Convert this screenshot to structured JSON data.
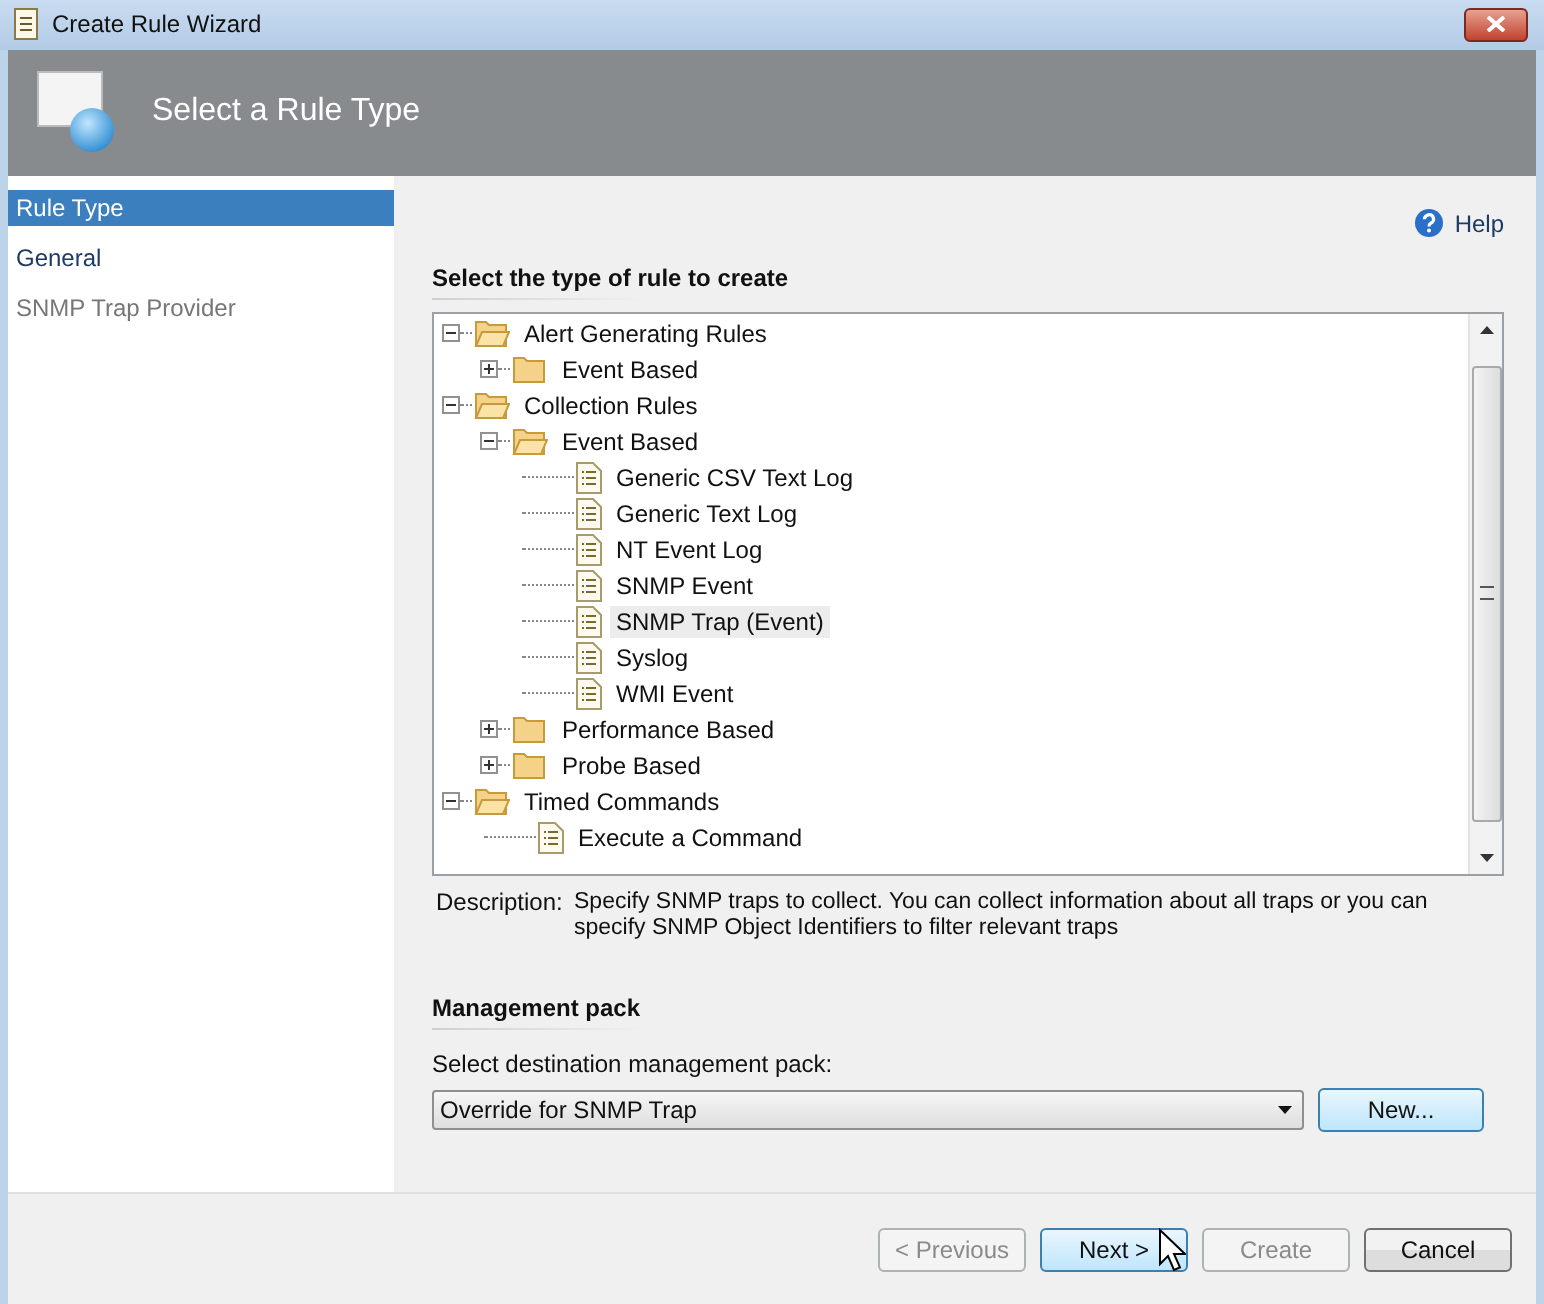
{
  "window": {
    "title": "Create Rule Wizard"
  },
  "header": {
    "title": "Select a Rule Type"
  },
  "sidebar": {
    "items": [
      {
        "label": "Rule Type",
        "selected": true,
        "disabled": false
      },
      {
        "label": "General",
        "selected": false,
        "disabled": false
      },
      {
        "label": "SNMP Trap Provider",
        "selected": false,
        "disabled": true
      }
    ]
  },
  "help": {
    "label": "Help"
  },
  "rule_type": {
    "heading": "Select the type of rule to create",
    "tree": [
      {
        "kind": "folder",
        "label": "Alert Generating Rules",
        "expanded": true,
        "selected": false,
        "children": [
          {
            "kind": "folder",
            "label": "Event Based",
            "expanded": false,
            "selected": false
          }
        ]
      },
      {
        "kind": "folder",
        "label": "Collection Rules",
        "expanded": true,
        "selected": false,
        "children": [
          {
            "kind": "folder",
            "label": "Event Based",
            "expanded": true,
            "selected": false,
            "children": [
              {
                "kind": "rule",
                "label": "Generic CSV Text Log",
                "selected": false
              },
              {
                "kind": "rule",
                "label": "Generic Text Log",
                "selected": false
              },
              {
                "kind": "rule",
                "label": "NT Event Log",
                "selected": false
              },
              {
                "kind": "rule",
                "label": "SNMP Event",
                "selected": false
              },
              {
                "kind": "rule",
                "label": "SNMP Trap (Event)",
                "selected": true
              },
              {
                "kind": "rule",
                "label": "Syslog",
                "selected": false
              },
              {
                "kind": "rule",
                "label": "WMI Event",
                "selected": false
              }
            ]
          },
          {
            "kind": "folder",
            "label": "Performance Based",
            "expanded": false,
            "selected": false
          },
          {
            "kind": "folder",
            "label": "Probe Based",
            "expanded": false,
            "selected": false
          }
        ]
      },
      {
        "kind": "folder",
        "label": "Timed Commands",
        "expanded": true,
        "selected": false,
        "children": [
          {
            "kind": "rule",
            "label": "Execute a Command",
            "selected": false
          }
        ]
      }
    ],
    "description_label": "Description:",
    "description": "Specify SNMP traps to collect. You can collect information about all traps or you can specify SNMP Object Identifiers to filter relevant traps"
  },
  "management_pack": {
    "heading": "Management pack",
    "label": "Select destination management pack:",
    "value": "Override for SNMP Trap",
    "new_button": "New..."
  },
  "footer": {
    "buttons": [
      {
        "label": "< Previous",
        "disabled": true,
        "default": false
      },
      {
        "label": "Next >",
        "disabled": false,
        "default": true
      },
      {
        "label": "Create",
        "disabled": true,
        "default": false
      },
      {
        "label": "Cancel",
        "disabled": false,
        "default": false
      }
    ]
  }
}
